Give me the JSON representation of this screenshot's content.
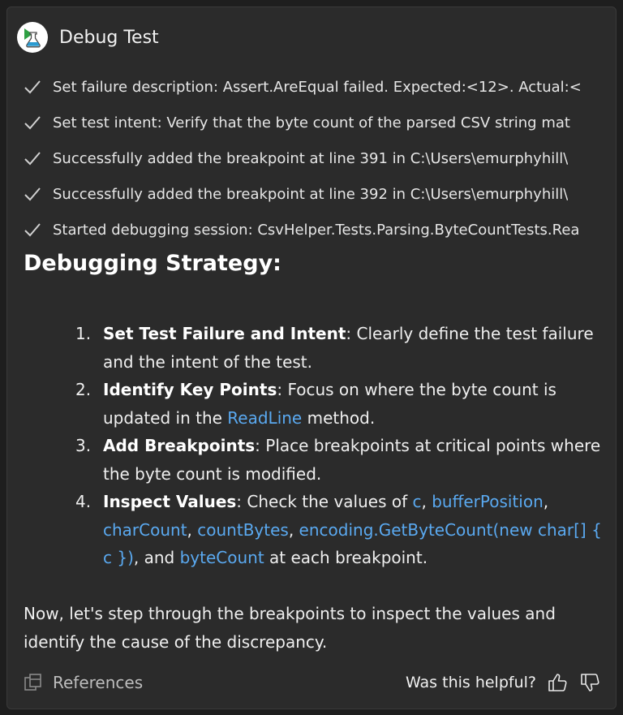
{
  "header": {
    "title": "Debug Test",
    "icon": "flask-play-icon"
  },
  "steps": [
    "Set failure description: Assert.AreEqual failed. Expected:<12>. Actual:<",
    "Set test intent: Verify that the byte count of the parsed CSV string mat",
    "Successfully added the breakpoint at line 391 in C:\\Users\\emurphyhill\\",
    "Successfully added the breakpoint at line 392 in C:\\Users\\emurphyhill\\",
    "Started debugging session: CsvHelper.Tests.Parsing.ByteCountTests.Rea"
  ],
  "strategy": {
    "heading": "Debugging Strategy:",
    "items": [
      {
        "num": "1.",
        "bold": "Set Test Failure and Intent",
        "text": ": Clearly define the test failure and the intent of the test."
      },
      {
        "num": "2.",
        "bold": "Identify Key Points",
        "text1": ": Focus on where the byte count is updated in the ",
        "code1": "ReadLine",
        "text2": " method."
      },
      {
        "num": "3.",
        "bold": "Add Breakpoints",
        "text": ": Place breakpoints at critical points where the byte count is modified."
      },
      {
        "num": "4.",
        "bold": "Inspect Values",
        "t1": ": Check the values of ",
        "c1": "c",
        "t2": ", ",
        "c2": "bufferPosition",
        "t3": ", ",
        "c3": "charCount",
        "t4": ", ",
        "c4": "countBytes",
        "t5": ", ",
        "c5": "encoding.GetByteCount(new char[] { c })",
        "t6": ", and ",
        "c6": "byteCount",
        "t7": " at each breakpoint."
      }
    ]
  },
  "closing": "Now, let's step through the breakpoints to inspect the values and identify the cause of the discrepancy.",
  "footer": {
    "references": "References",
    "helpful": "Was this helpful?"
  },
  "colors": {
    "accent_code": "#5aa9f0",
    "panel_bg": "#2b2b2b",
    "logo_green": "#2ea043"
  }
}
